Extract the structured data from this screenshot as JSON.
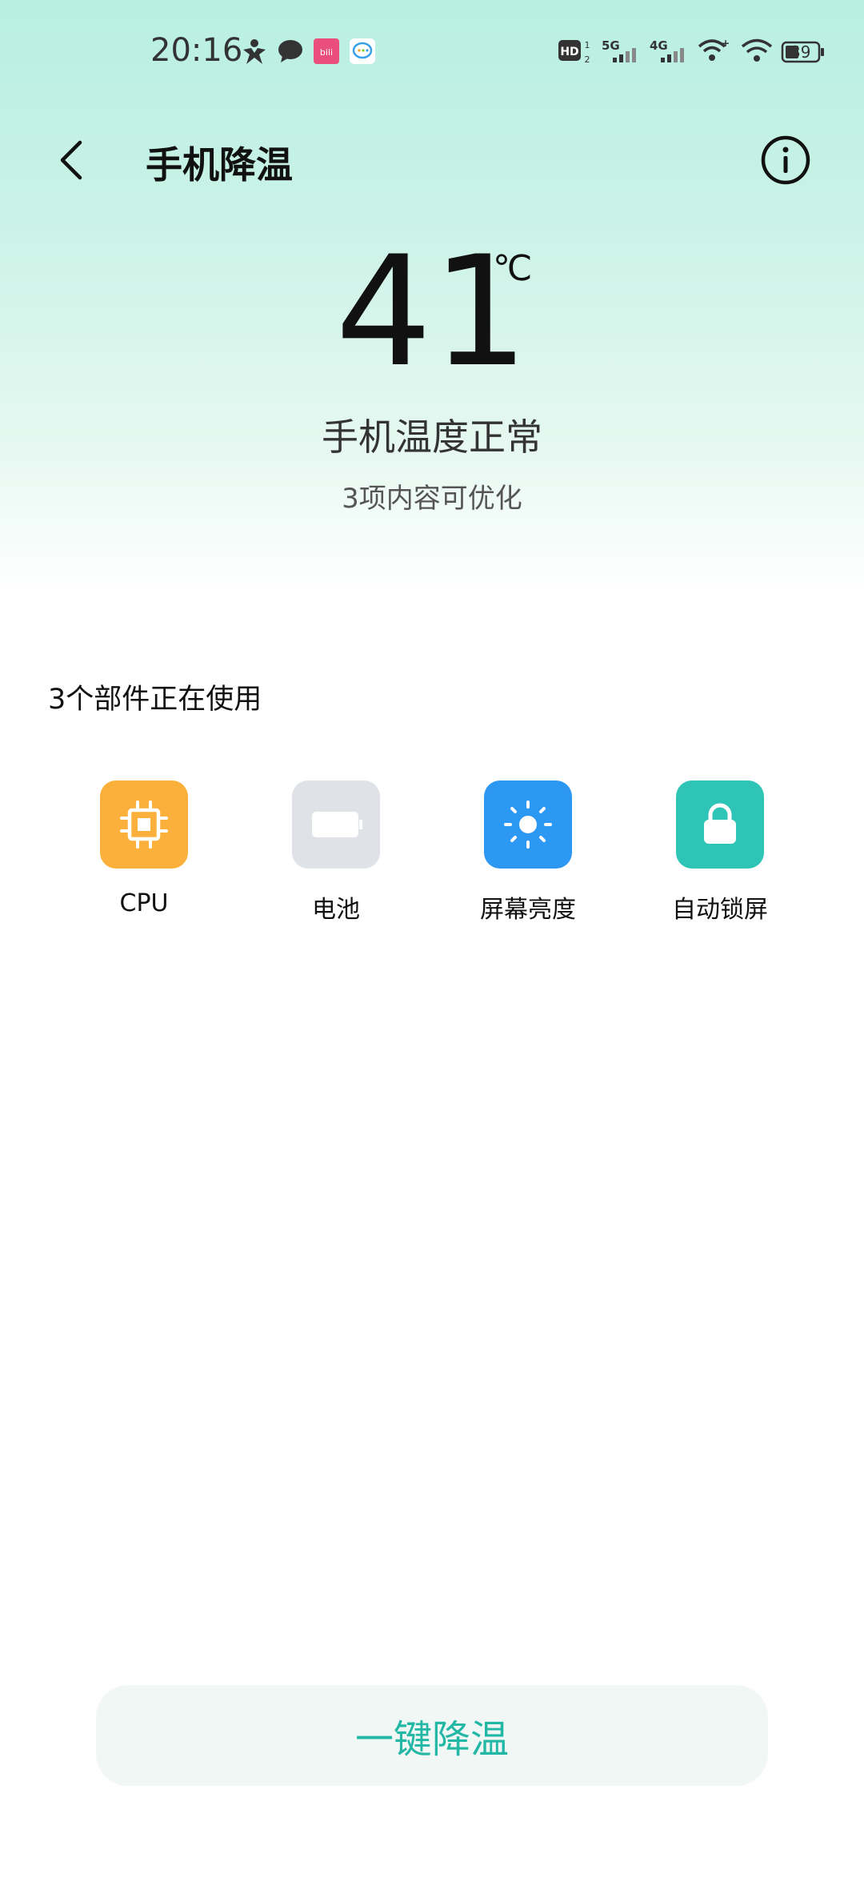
{
  "status_bar": {
    "time": "20:16",
    "battery_level": "39",
    "icons": [
      "person-app-icon",
      "chat-bubble-icon",
      "pink-app-icon",
      "message-app-icon",
      "hd-icon",
      "signal-5g-icon",
      "signal-4g-icon",
      "wifi-plus-icon",
      "wifi-icon",
      "battery-icon"
    ]
  },
  "header": {
    "title": "手机降温",
    "back_icon": "back-arrow-icon",
    "info_icon": "info-icon"
  },
  "temperature": {
    "value": "41",
    "unit": "℃",
    "status": "手机温度正常",
    "optimize_text": "3项内容可优化"
  },
  "components": {
    "heading": "3个部件正在使用",
    "items": [
      {
        "label": "CPU",
        "icon": "cpu-icon",
        "color": "#fbb03b"
      },
      {
        "label": "电池",
        "icon": "battery-icon",
        "color": "#dfe3e7"
      },
      {
        "label": "屏幕亮度",
        "icon": "brightness-icon",
        "color": "#2d97f4"
      },
      {
        "label": "自动锁屏",
        "icon": "lock-icon",
        "color": "#2ec4b6"
      }
    ]
  },
  "action": {
    "label": "一键降温",
    "color": "#23b7a6"
  }
}
